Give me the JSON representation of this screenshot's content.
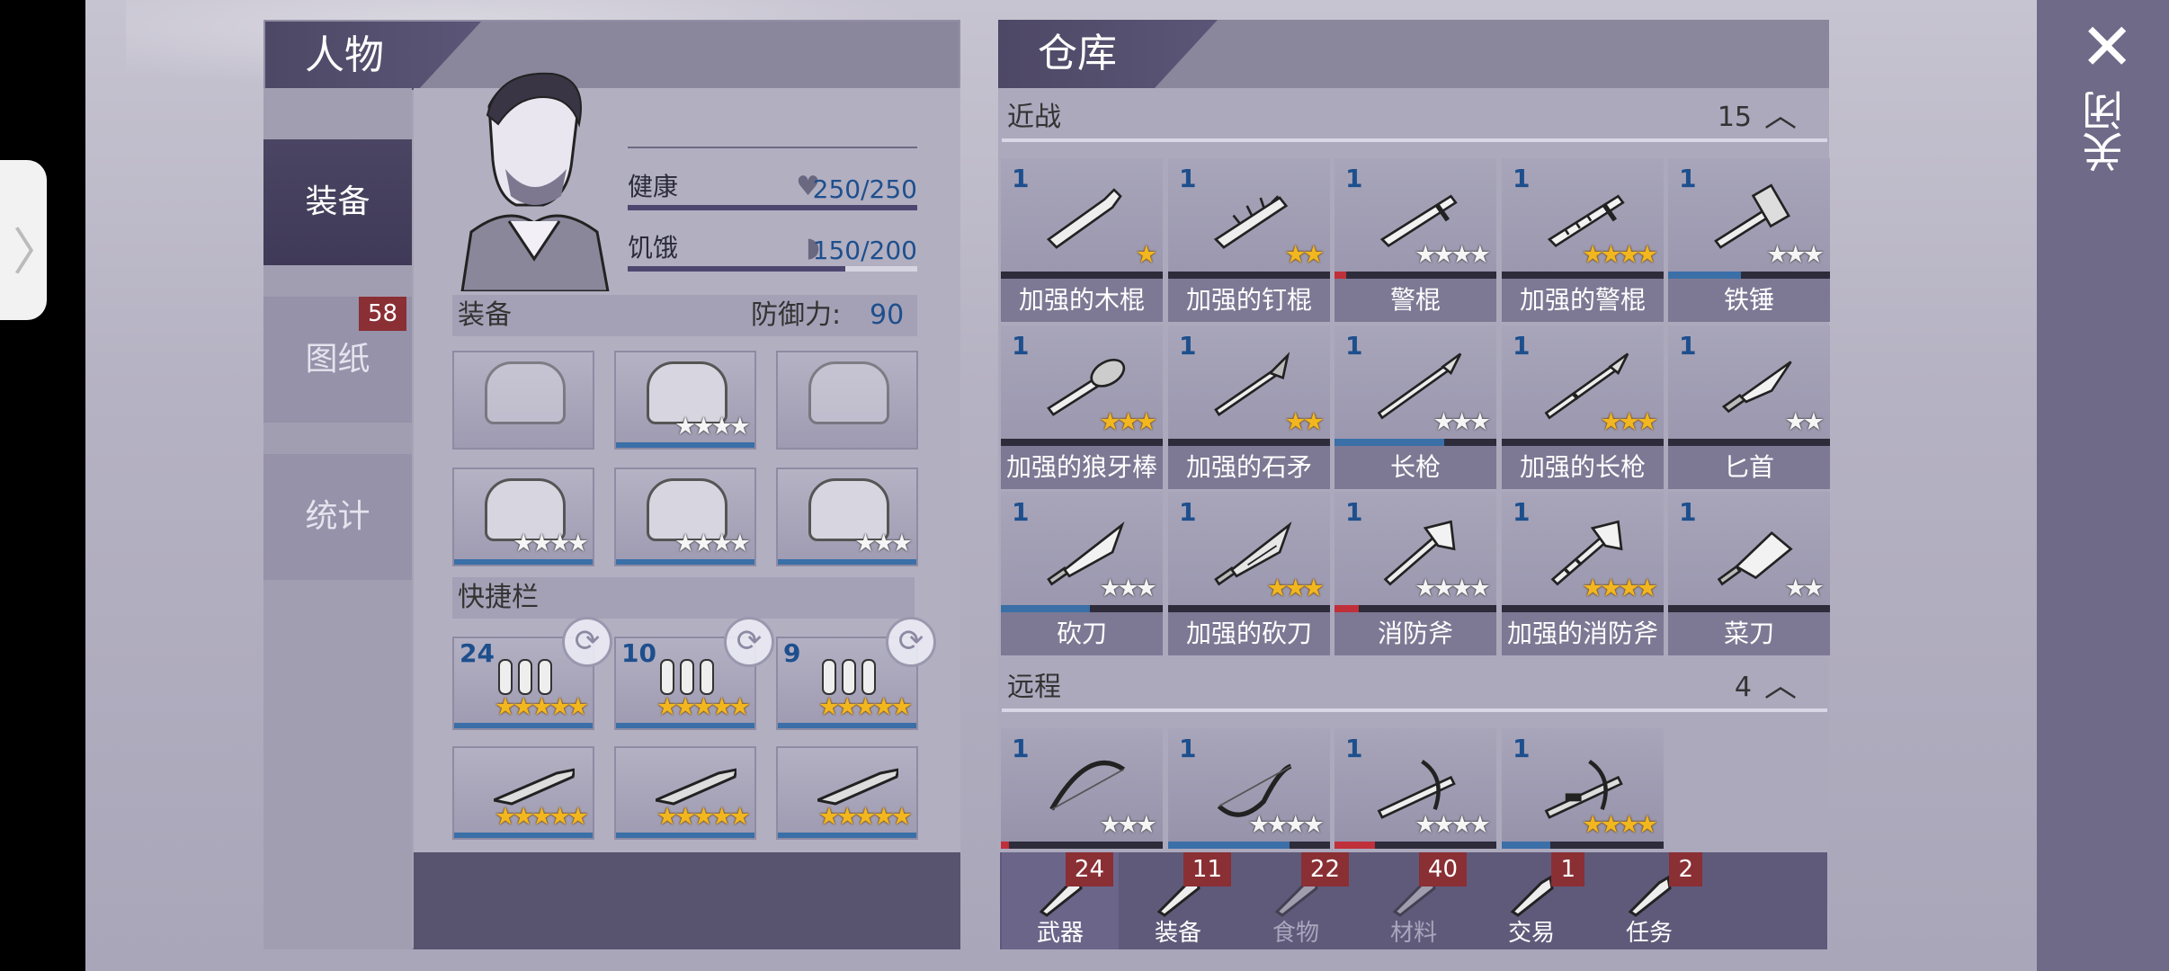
{
  "left_panel": {
    "title": "人物",
    "tabs": [
      {
        "label": "装备"
      },
      {
        "label": "图纸",
        "badge": "58"
      },
      {
        "label": "统计"
      }
    ],
    "stats": [
      {
        "label": "健康",
        "icon": "heart-icon",
        "value": "250/250",
        "fill": 1.0
      },
      {
        "label": "饥饿",
        "icon": "stomach-icon",
        "value": "150/200",
        "fill": 0.75
      }
    ],
    "equipment_label": "装备",
    "defense_label": "防御力:",
    "defense_value": "90",
    "equipment_slots": [
      {
        "slot": "helmet",
        "icon": "helmet-icon",
        "stars": 0,
        "gold": 0
      },
      {
        "slot": "shirt",
        "icon": "shirt-icon",
        "stars": 4,
        "gold": 0
      },
      {
        "slot": "jacket",
        "icon": "jacket-icon",
        "stars": 0,
        "gold": 0
      },
      {
        "slot": "gloves",
        "icon": "gloves-icon",
        "stars": 4,
        "gold": 0
      },
      {
        "slot": "pants",
        "icon": "pants-icon",
        "stars": 4,
        "gold": 0
      },
      {
        "slot": "shoes",
        "icon": "shoes-icon",
        "stars": 3,
        "gold": 0
      }
    ],
    "quickbar_label": "快捷栏",
    "quickbar": [
      {
        "count": "24",
        "icon": "bullets-icon",
        "stars": 5,
        "gold": 5
      },
      {
        "count": "10",
        "icon": "shotgun-shells-icon",
        "stars": 5,
        "gold": 5
      },
      {
        "count": "9",
        "icon": "cartridges-icon",
        "stars": 5,
        "gold": 5
      },
      {
        "count": "",
        "icon": "rifle-icon",
        "stars": 5,
        "gold": 5
      },
      {
        "count": "",
        "icon": "shotgun-icon",
        "stars": 5,
        "gold": 5
      },
      {
        "count": "",
        "icon": "revolver-icon",
        "stars": 5,
        "gold": 5
      }
    ]
  },
  "storage": {
    "title": "仓库",
    "melee": {
      "label": "近战",
      "count": "15",
      "items": [
        {
          "count": "1",
          "name": "加强的木棍",
          "icon": "club-icon",
          "stars": 1,
          "gold": 1,
          "durability": 1.0,
          "bar": "#2e2b3a"
        },
        {
          "count": "1",
          "name": "加强的钉棍",
          "icon": "spiked-club-icon",
          "stars": 2,
          "gold": 2,
          "durability": 1.0,
          "bar": "#2e2b3a"
        },
        {
          "count": "1",
          "name": "警棍",
          "icon": "baton-icon",
          "stars": 4,
          "gold": 0,
          "durability": 0.07,
          "bar": "#c0303a"
        },
        {
          "count": "1",
          "name": "加强的警棍",
          "icon": "reinforced-baton-icon",
          "stars": 4,
          "gold": 4,
          "durability": 1.0,
          "bar": "#2e2b3a"
        },
        {
          "count": "1",
          "name": "铁锤",
          "icon": "hammer-icon",
          "stars": 3,
          "gold": 0,
          "durability": 0.45,
          "bar": "#3a6fa8"
        },
        {
          "count": "1",
          "name": "加强的狼牙棒",
          "icon": "mace-icon",
          "stars": 3,
          "gold": 3,
          "durability": 1.0,
          "bar": "#2e2b3a"
        },
        {
          "count": "1",
          "name": "加强的石矛",
          "icon": "stone-spear-icon",
          "stars": 2,
          "gold": 2,
          "durability": 1.0,
          "bar": "#2e2b3a"
        },
        {
          "count": "1",
          "name": "长枪",
          "icon": "spear-icon",
          "stars": 3,
          "gold": 0,
          "durability": 0.68,
          "bar": "#3a6fa8"
        },
        {
          "count": "1",
          "name": "加强的长枪",
          "icon": "reinforced-spear-icon",
          "stars": 3,
          "gold": 3,
          "durability": 1.0,
          "bar": "#2e2b3a"
        },
        {
          "count": "1",
          "name": "匕首",
          "icon": "dagger-icon",
          "stars": 2,
          "gold": 0,
          "durability": 1.0,
          "bar": "#2e2b3a"
        },
        {
          "count": "1",
          "name": "砍刀",
          "icon": "machete-icon",
          "stars": 3,
          "gold": 0,
          "durability": 0.55,
          "bar": "#3a6fa8"
        },
        {
          "count": "1",
          "name": "加强的砍刀",
          "icon": "reinforced-machete-icon",
          "stars": 3,
          "gold": 3,
          "durability": 1.0,
          "bar": "#2e2b3a"
        },
        {
          "count": "1",
          "name": "消防斧",
          "icon": "fire-axe-icon",
          "stars": 4,
          "gold": 0,
          "durability": 0.15,
          "bar": "#c0303a"
        },
        {
          "count": "1",
          "name": "加强的消防斧",
          "icon": "reinforced-fire-axe-icon",
          "stars": 4,
          "gold": 4,
          "durability": 1.0,
          "bar": "#2e2b3a"
        },
        {
          "count": "1",
          "name": "菜刀",
          "icon": "cleaver-icon",
          "stars": 2,
          "gold": 0,
          "durability": 1.0,
          "bar": "#2e2b3a"
        }
      ]
    },
    "ranged": {
      "label": "远程",
      "count": "4",
      "items": [
        {
          "count": "1",
          "name": "",
          "icon": "bow-icon",
          "stars": 3,
          "gold": 0,
          "durability": 0.05,
          "bar": "#c0303a"
        },
        {
          "count": "1",
          "name": "",
          "icon": "recurve-bow-icon",
          "stars": 4,
          "gold": 0,
          "durability": 0.75,
          "bar": "#3a6fa8"
        },
        {
          "count": "1",
          "name": "",
          "icon": "crossbow-icon",
          "stars": 4,
          "gold": 0,
          "durability": 0.25,
          "bar": "#c0303a"
        },
        {
          "count": "1",
          "name": "",
          "icon": "reinforced-crossbow-icon",
          "stars": 4,
          "gold": 4,
          "durability": 0.3,
          "bar": "#3a6fa8"
        }
      ]
    },
    "bottom_tabs": [
      {
        "label": "武器",
        "badge": "24",
        "icon": "weapon-icon",
        "dim": false
      },
      {
        "label": "装备",
        "badge": "11",
        "icon": "shirt-icon",
        "dim": false
      },
      {
        "label": "食物",
        "badge": "22",
        "icon": "food-icon",
        "dim": true
      },
      {
        "label": "材料",
        "badge": "40",
        "icon": "material-icon",
        "dim": true
      },
      {
        "label": "交易",
        "badge": "1",
        "icon": "trade-icon",
        "dim": false
      },
      {
        "label": "任务",
        "badge": "2",
        "icon": "key-icon",
        "dim": false
      }
    ]
  },
  "close": {
    "label": "关闭",
    "icon": "close-icon"
  },
  "colors": {
    "accent": "#4d4865",
    "badge": "#8a2f34",
    "value_blue": "#1e4f8d",
    "star_gold": "#f2b71f"
  }
}
